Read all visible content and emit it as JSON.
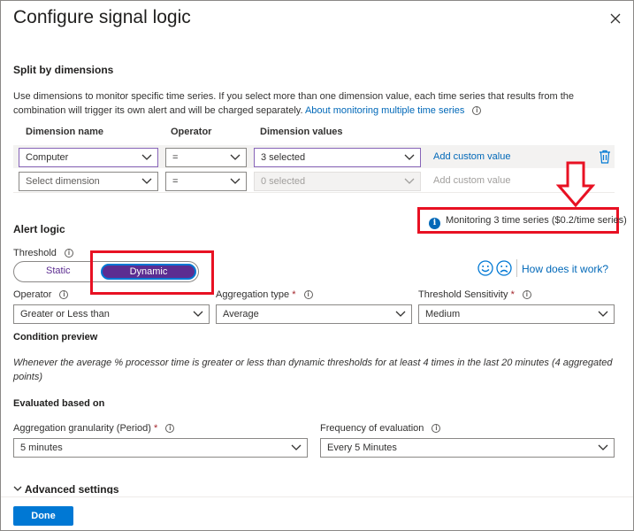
{
  "panel": {
    "title": "Configure signal logic"
  },
  "split": {
    "heading": "Split by dimensions",
    "description": "Use dimensions to monitor specific time series. If you select more than one dimension value, each time series that results from the combination will trigger its own alert and will be charged separately.",
    "link": "About monitoring multiple time series",
    "columns": {
      "name": "Dimension name",
      "operator": "Operator",
      "values": "Dimension values"
    },
    "rows": [
      {
        "name": "Computer",
        "operator": "=",
        "values": "3 selected",
        "add_label": "Add custom value"
      },
      {
        "name": "Select dimension",
        "operator": "=",
        "values": "0 selected",
        "add_label": "Add custom value"
      }
    ],
    "monitoring": "Monitoring 3 time series ($0.2/time series)"
  },
  "alert": {
    "heading": "Alert logic",
    "threshold_label": "Threshold",
    "threshold_options": [
      "Static",
      "Dynamic"
    ],
    "threshold_selected": "Dynamic",
    "how_link": "How does it work?",
    "operator_label": "Operator",
    "operator_value": "Greater or Less than",
    "aggregation_label": "Aggregation type",
    "aggregation_value": "Average",
    "sensitivity_label": "Threshold Sensitivity",
    "sensitivity_value": "Medium",
    "required_mark": "*",
    "info_mark": "i"
  },
  "condition": {
    "heading": "Condition preview",
    "text": "Whenever the average % processor time is greater or less than dynamic thresholds for at least 4 times in the last 20 minutes (4 aggregated points)"
  },
  "evaluation": {
    "heading": "Evaluated based on",
    "granularity_label": "Aggregation granularity (Period)",
    "granularity_value": "5 minutes",
    "frequency_label": "Frequency of evaluation",
    "frequency_value": "Every 5 Minutes"
  },
  "advanced": {
    "label": "Advanced settings"
  },
  "footer": {
    "done_label": "Done"
  },
  "colors": {
    "accent": "#0078d4",
    "dynamic": "#5c2d91",
    "annotation": "#e81123"
  }
}
